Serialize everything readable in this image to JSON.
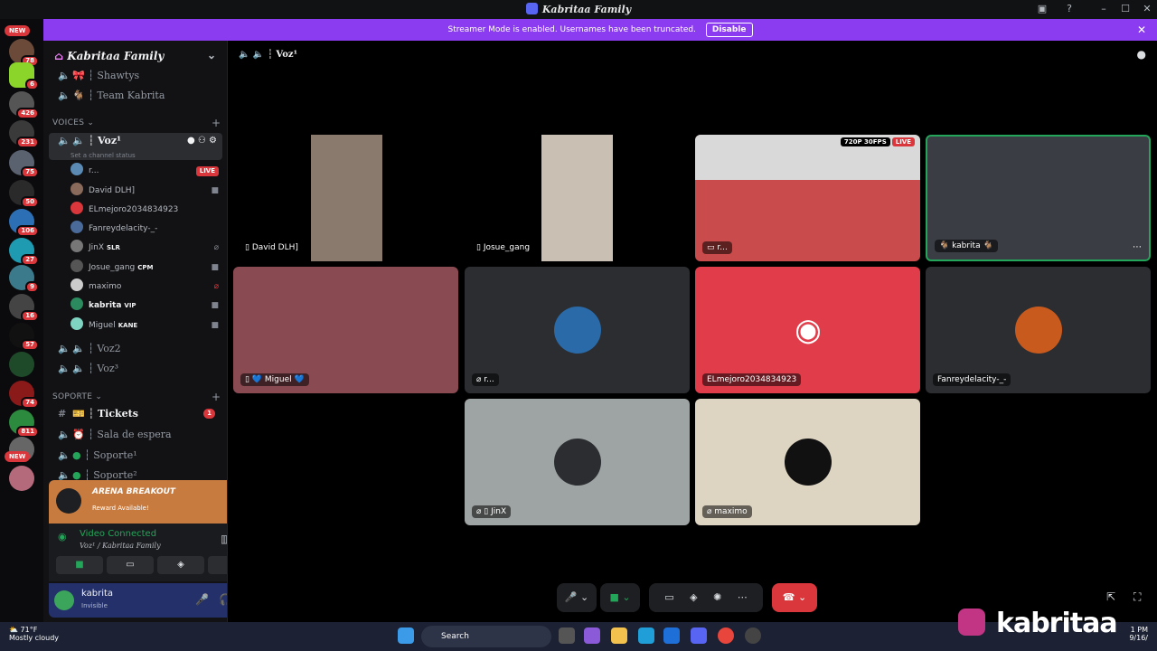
{
  "window": {
    "title": "Kabritaa Family"
  },
  "banner": {
    "text": "Streamer Mode is enabled. Usernames have been truncated.",
    "disable_label": "Disable"
  },
  "rail": {
    "new_top": "NEW",
    "new_bottom": "NEW",
    "badges": [
      "78",
      "6",
      "426",
      "231",
      "75",
      "50",
      "106",
      "27",
      "9",
      "16",
      "57",
      "74",
      "811"
    ]
  },
  "guild": {
    "name": "Kabritaa Family"
  },
  "channels": {
    "top": [
      "Shawtys",
      "Team Kabrita"
    ],
    "voices_label": "VOICES",
    "active": {
      "name": "Voz¹",
      "status": "Set a channel status"
    },
    "members": [
      {
        "name": "r...",
        "tag": "",
        "badge": "LIVE"
      },
      {
        "name": "David DLH]",
        "tag": ""
      },
      {
        "name": "ELmejoro2034834923",
        "tag": ""
      },
      {
        "name": "Fanreydelacity-_-",
        "tag": ""
      },
      {
        "name": "JinX",
        "tag": "SLR"
      },
      {
        "name": "Josue_gang",
        "tag": "CPM"
      },
      {
        "name": "maximo",
        "tag": ""
      },
      {
        "name": "kabrita",
        "tag": "VIP"
      },
      {
        "name": "Miguel",
        "tag": "KANE"
      }
    ],
    "voz2": "Voz2",
    "voz3": "Voz³",
    "soporte_label": "SOPORTE",
    "tickets": "Tickets",
    "tickets_count": "1",
    "sala": "Sala de espera",
    "soporte1": "Soporte¹",
    "soporte2": "Soporte²"
  },
  "promo": {
    "title": "ARENA BREAKOUT",
    "subtitle": "Reward Available!"
  },
  "voice": {
    "status": "Video Connected",
    "location": "Voz¹ / Kabritaa Family"
  },
  "user": {
    "name": "kabrita",
    "status": "Invisible"
  },
  "main": {
    "channel": "Voz¹",
    "tiles": {
      "david": "David DLH]",
      "josue": "Josue_gang",
      "stream": "r...",
      "stream_quality": "720P 30FPS",
      "stream_live": "LIVE",
      "kabrita": "kabrita",
      "miguel": "Miguel",
      "r": "r...",
      "elmejoro": "ELmejoro2034834923",
      "fanrey": "Fanreydelacity-_-",
      "jinx": "JinX",
      "maximo": "maximo"
    }
  },
  "taskbar": {
    "temp": "71°F",
    "weather": "Mostly cloudy",
    "search": "Search",
    "time": "1 PM",
    "date": "9/16/"
  },
  "watermark": {
    "text": "kabritaa"
  },
  "colors": {
    "accent": "#5865f2",
    "banner": "#8b3cf0",
    "live": "#da373c",
    "connected": "#23a55a"
  }
}
